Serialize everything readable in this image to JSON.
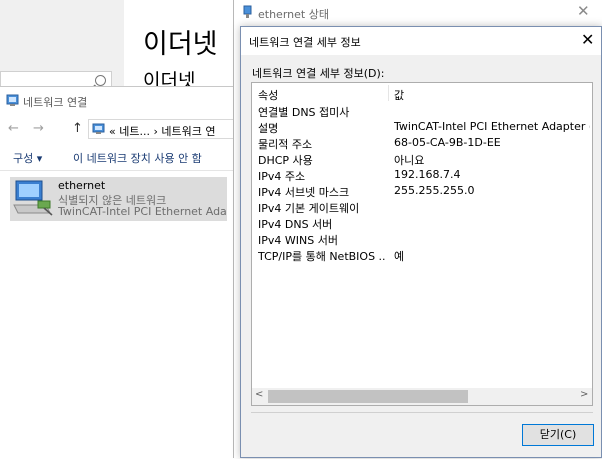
{
  "settings_window": {
    "heading": "이더넷",
    "subheading": "이더넷"
  },
  "network_connections": {
    "title": "네트워크 연결",
    "nav": {
      "back": "←",
      "forward": "→",
      "up": "↑"
    },
    "address": "« 네트... › 네트워크 연",
    "commands": {
      "organize": "구성 ▾",
      "disable": "이 네트워크 장치 사용 안 함"
    },
    "adapter": {
      "name": "ethernet",
      "status": "식별되지 않은 네트워크",
      "description": "TwinCAT-Intel PCI Ethernet Adap..."
    }
  },
  "ethernet_status": {
    "title": "ethernet 상태",
    "close": "✕"
  },
  "details_dialog": {
    "title": "네트워크 연결 세부 정보",
    "close": "✕",
    "label": "네트워크 연결 세부 정보(D):",
    "columns": {
      "property": "속성",
      "value": "값"
    },
    "rows": [
      {
        "property": "연결별 DNS 접미사",
        "value": ""
      },
      {
        "property": "설명",
        "value": "TwinCAT-Intel PCI Ethernet Adapter (Gigab"
      },
      {
        "property": "물리적 주소",
        "value": "68-05-CA-9B-1D-EE"
      },
      {
        "property": "DHCP 사용",
        "value": "아니요"
      },
      {
        "property": "IPv4 주소",
        "value": "192.168.7.4"
      },
      {
        "property": "IPv4 서브넷 마스크",
        "value": "255.255.255.0"
      },
      {
        "property": "IPv4 기본 게이트웨이",
        "value": ""
      },
      {
        "property": "IPv4 DNS 서버",
        "value": ""
      },
      {
        "property": "IPv4 WINS 서버",
        "value": ""
      },
      {
        "property": "TCP/IP를 통해 NetBIOS ...",
        "value": "예"
      }
    ],
    "scroll_left": "<",
    "scroll_right": ">",
    "close_button": "닫기(C)"
  },
  "colors": {
    "accent": "#0078d7",
    "link": "#1a3b73",
    "selection": "#dcdcdc"
  }
}
